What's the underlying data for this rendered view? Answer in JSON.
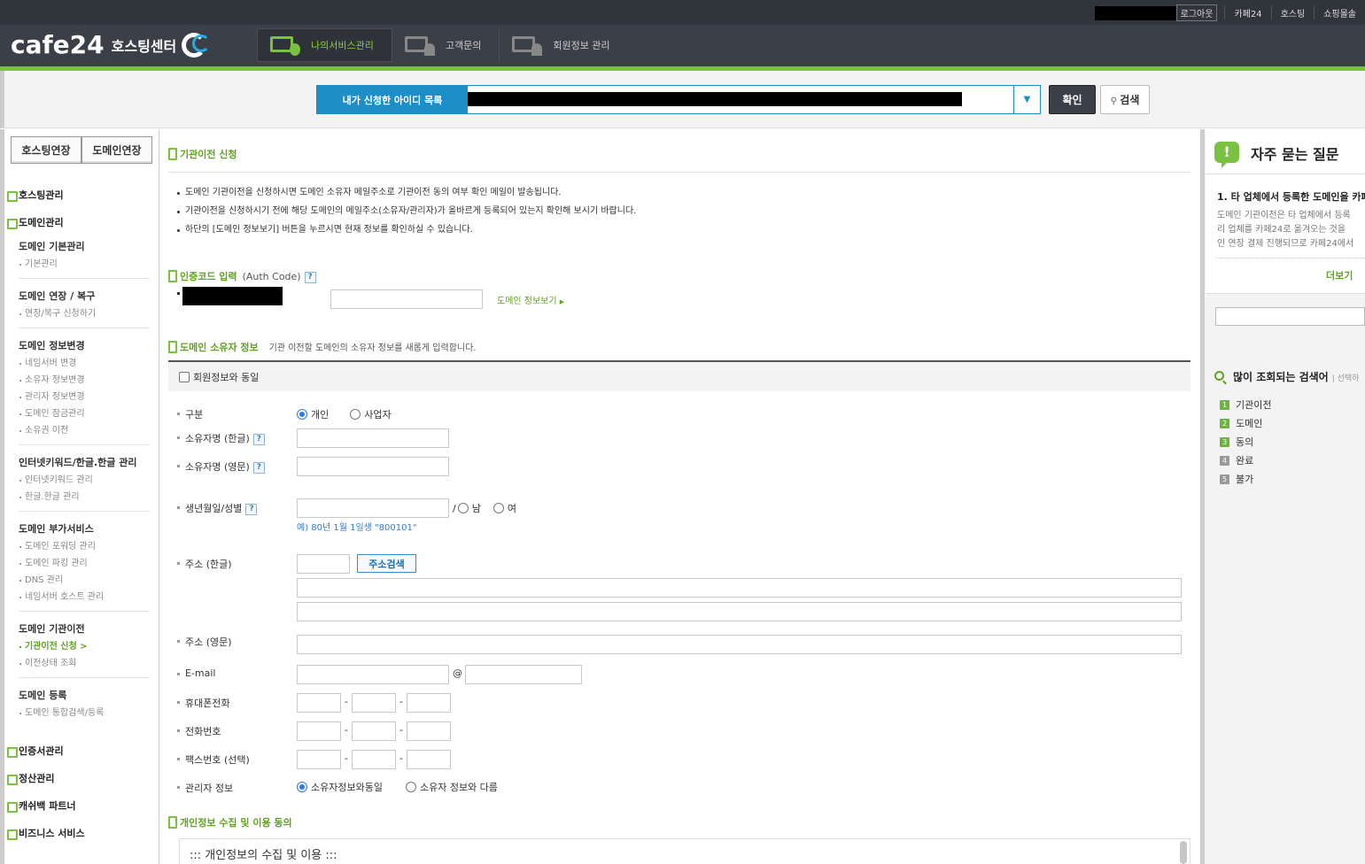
{
  "top": {
    "logout": "로그아웃",
    "links": [
      "카페24",
      "호스팅",
      "쇼핑몰솔"
    ]
  },
  "brand": {
    "word": "cafe24",
    "sub": "호스팅센터"
  },
  "nav": [
    {
      "label": "나의서비스관리",
      "active": true
    },
    {
      "label": "고객문의",
      "active": false
    },
    {
      "label": "회원정보 관리",
      "active": false
    }
  ],
  "search": {
    "id_label": "내가 신청한 아이디 목록",
    "confirm": "확인",
    "search": "검색"
  },
  "left": {
    "tabs": [
      "호스팅연장",
      "도메인연장"
    ],
    "cats_top": [
      "호스팅관리",
      "도메인관리"
    ],
    "groups": [
      {
        "title": "도메인 기본관리",
        "items": [
          "기본관리"
        ]
      },
      {
        "title": "도메인 연장 / 복구",
        "items": [
          "연장/복구 신청하기"
        ]
      },
      {
        "title": "도메인 정보변경",
        "items": [
          "네임서버 변경",
          "소유자 정보변경",
          "관리자 정보변경",
          "도메인 잠금관리",
          "소유권 이전"
        ]
      },
      {
        "title": "인터넷키워드/한글.한글 관리",
        "items": [
          "인터넷키워드 관리",
          "한글.한글 관리"
        ]
      },
      {
        "title": "도메인 부가서비스",
        "items": [
          "도메인 포워딩 관리",
          "도메인 파킹 관리",
          "DNS 관리",
          "네임서버 호스트 관리"
        ]
      },
      {
        "title": "도메인 기관이전",
        "items": [
          "기관이전 신청 >",
          "이전상태 조회"
        ]
      },
      {
        "title": "도메인 등록",
        "items": [
          "도메인 통합검색/등록"
        ]
      }
    ],
    "cats_bottom": [
      "인증서관리",
      "정산관리",
      "캐쉬백 파트너",
      "비즈니스 서비스"
    ]
  },
  "main": {
    "sec1_title": "기관이전 신청",
    "bullets": [
      "도메인 기관이전을 신청하시면 도메인 소유자 메일주소로 기관이전 동의 여부 확인 메일이 발송됩니다.",
      "기관이전을 신청하시기 전에 해당 도메인의 메일주소(소유자/관리자)가 올바르게 등록되어 있는지 확인해 보시기 바랍니다.",
      "하단의 [도메인 정보보기] 버튼을 누르시면 현재 정보를 확인하실 수 있습니다."
    ],
    "auth_title": "인증코드 입력",
    "auth_sub": "(Auth Code)",
    "qmark": "?",
    "domain_info_link": "도메인 정보보기",
    "owner_title": "도메인 소유자 정보",
    "owner_desc": "기관 이전할 도메인의 소유자 정보를 새롭게 입력합니다.",
    "same_as_member": "회원정보와 동일",
    "fields": {
      "type": "구분",
      "type_opt1": "개인",
      "type_opt2": "사업자",
      "name_ko": "소유자명 (한글)",
      "name_en": "소유자명 (영문)",
      "birth": "생년월일/성별",
      "slash": "/",
      "male": "남",
      "female": "여",
      "birth_hint": "예) 80년 1월 1일생 \"800101\"",
      "addr_ko": "주소 (한글)",
      "addr_btn": "주소검색",
      "addr_en": "주소 (영문)",
      "email": "E-mail",
      "at": "@",
      "mobile": "휴대폰전화",
      "phone": "전화번호",
      "fax": "팩스번호 (선택)",
      "dash": "-",
      "admin": "관리자 정보",
      "admin_opt1": "소유자정보와동일",
      "admin_opt2": "소유자 정보와 다름"
    },
    "privacy_title": "개인정보 수집 및 이용 동의",
    "privacy_text": "::: 개인정보의 수집 및 이용 :::"
  },
  "right": {
    "faq_icon": "!",
    "faq_title": "자주 묻는 질문",
    "faq_q": "1. 타 업체에서 등록한 도메인을 카페",
    "faq_a": [
      "도메인 기관이전은 타 업체에서 등록",
      "리 업체를 카페24로 옮겨오는 것을",
      "인 연장 결제 진행되므로 카페24에서"
    ],
    "faq_more": "더보기",
    "popular_title": "많이 조회되는 검색어",
    "popular_sub": "| 선택하",
    "popular": [
      {
        "rank": "1",
        "word": "기관이전",
        "color": "#6db33f"
      },
      {
        "rank": "2",
        "word": "도메인",
        "color": "#6db33f"
      },
      {
        "rank": "3",
        "word": "동의",
        "color": "#6db33f"
      },
      {
        "rank": "4",
        "word": "완료",
        "color": "#999999"
      },
      {
        "rank": "5",
        "word": "불가",
        "color": "#999999"
      }
    ]
  }
}
